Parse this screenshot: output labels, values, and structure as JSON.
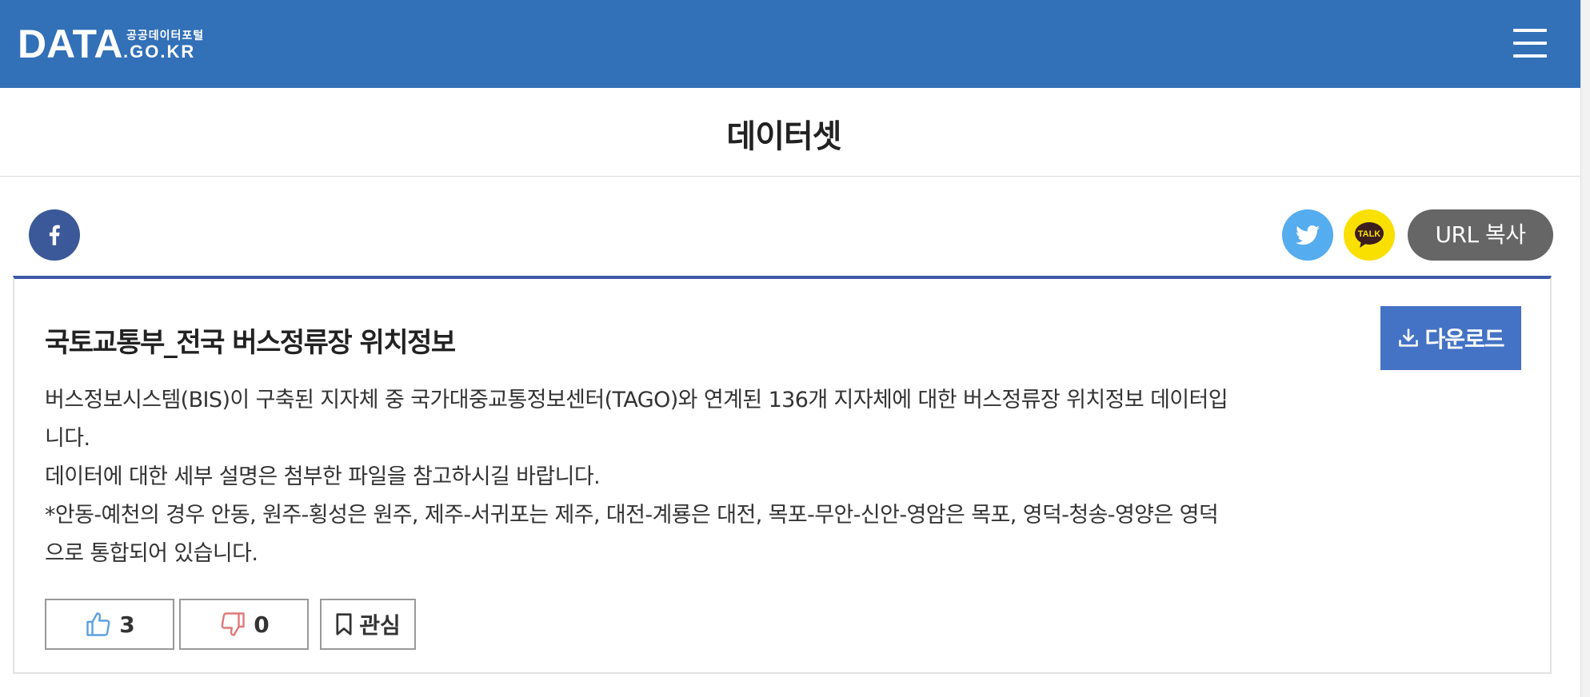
{
  "header": {
    "logo_main": "DATA",
    "logo_sub": "공공데이터포털",
    "logo_domain": ".GO.KR",
    "brand_color": "#3270b8"
  },
  "page": {
    "title": "데이터셋"
  },
  "share": {
    "facebook_icon": "facebook-icon",
    "twitter_icon": "twitter-icon",
    "kakaotalk_icon": "kakaotalk-icon",
    "kakaotalk_label": "TALK",
    "url_copy_label": "URL 복사"
  },
  "dataset": {
    "title": "국토교통부_전국 버스정류장 위치정보",
    "download_label": "다운로드",
    "description_lines": [
      "버스정보시스템(BIS)이 구축된 지자체 중 국가대중교통정보센터(TAGO)와 연계된 136개 지자체에 대한 버스정류장 위치정보 데이터입",
      "니다.",
      "데이터에 대한 세부 설명은 첨부한 파일을 참고하시길 바랍니다.",
      "*안동-예천의 경우 안동, 원주-횡성은 원주, 제주-서귀포는 제주, 대전-계룡은 대전, 목포-무안-신안-영암은 목포, 영덕-청송-영양은 영덕",
      "으로 통합되어 있습니다."
    ],
    "likes": "3",
    "dislikes": "0",
    "favorite_label": "관심"
  },
  "colors": {
    "accent": "#4472c4",
    "card_top_border": "#3d5aa8",
    "facebook": "#3b5998",
    "twitter": "#55acee",
    "kakaotalk": "#f9e000",
    "url_button": "#666666"
  }
}
